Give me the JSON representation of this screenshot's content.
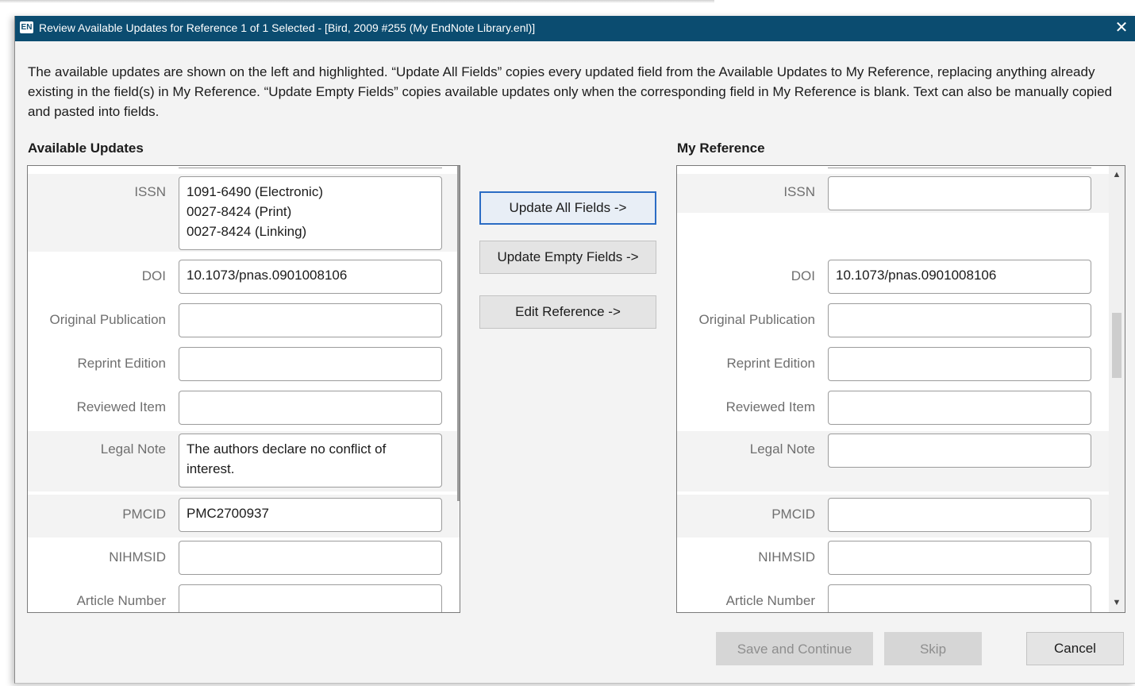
{
  "window": {
    "logo": "EN",
    "title": "Review Available Updates for Reference 1 of 1 Selected - [Bird, 2009 #255 (My EndNote Library.enl)]",
    "close": "✕"
  },
  "description": "The available updates are shown on the left and highlighted. “Update All Fields” copies every updated field from the Available Updates to My Reference, replacing anything already existing in the field(s) in My Reference. “Update Empty Fields” copies available updates only when the corresponding field in My Reference is blank. Text can also be manually copied and pasted into fields.",
  "available": {
    "heading": "Available Updates",
    "fields": [
      {
        "label": "ISSN",
        "lines": [
          "1091-6490 (Electronic)",
          "0027-8424 (Print)",
          "0027-8424 (Linking)"
        ]
      },
      {
        "label": "DOI",
        "lines": [
          "10.1073/pnas.0901008106"
        ]
      },
      {
        "label": "Original Publication",
        "lines": [
          ""
        ]
      },
      {
        "label": "Reprint Edition",
        "lines": [
          ""
        ]
      },
      {
        "label": "Reviewed Item",
        "lines": [
          ""
        ]
      },
      {
        "label": "Legal Note",
        "lines": [
          "The authors declare no conflict of",
          "interest."
        ]
      },
      {
        "label": "PMCID",
        "lines": [
          "PMC2700937"
        ]
      },
      {
        "label": "NIHMSID",
        "lines": [
          ""
        ]
      },
      {
        "label": "Article Number",
        "lines": [
          ""
        ]
      }
    ]
  },
  "mine": {
    "heading": "My Reference",
    "fields": [
      {
        "label": "ISSN",
        "lines": [
          ""
        ]
      },
      {
        "label": "DOI",
        "lines": [
          "10.1073/pnas.0901008106"
        ]
      },
      {
        "label": "Original Publication",
        "lines": [
          ""
        ]
      },
      {
        "label": "Reprint Edition",
        "lines": [
          ""
        ]
      },
      {
        "label": "Reviewed Item",
        "lines": [
          ""
        ]
      },
      {
        "label": "Legal Note",
        "lines": [
          ""
        ]
      },
      {
        "label": "PMCID",
        "lines": [
          ""
        ]
      },
      {
        "label": "NIHMSID",
        "lines": [
          ""
        ]
      },
      {
        "label": "Article Number",
        "lines": [
          ""
        ]
      }
    ]
  },
  "actions": {
    "update_all": "Update All Fields ->",
    "update_empty": "Update Empty Fields ->",
    "edit_reference": "Edit Reference ->"
  },
  "footer": {
    "save": "Save and Continue",
    "skip": "Skip",
    "cancel": "Cancel"
  },
  "colors": {
    "titlebar": "#0b4c70",
    "highlight_row": "#f3f3f3",
    "primary_border": "#2b6cc4"
  }
}
